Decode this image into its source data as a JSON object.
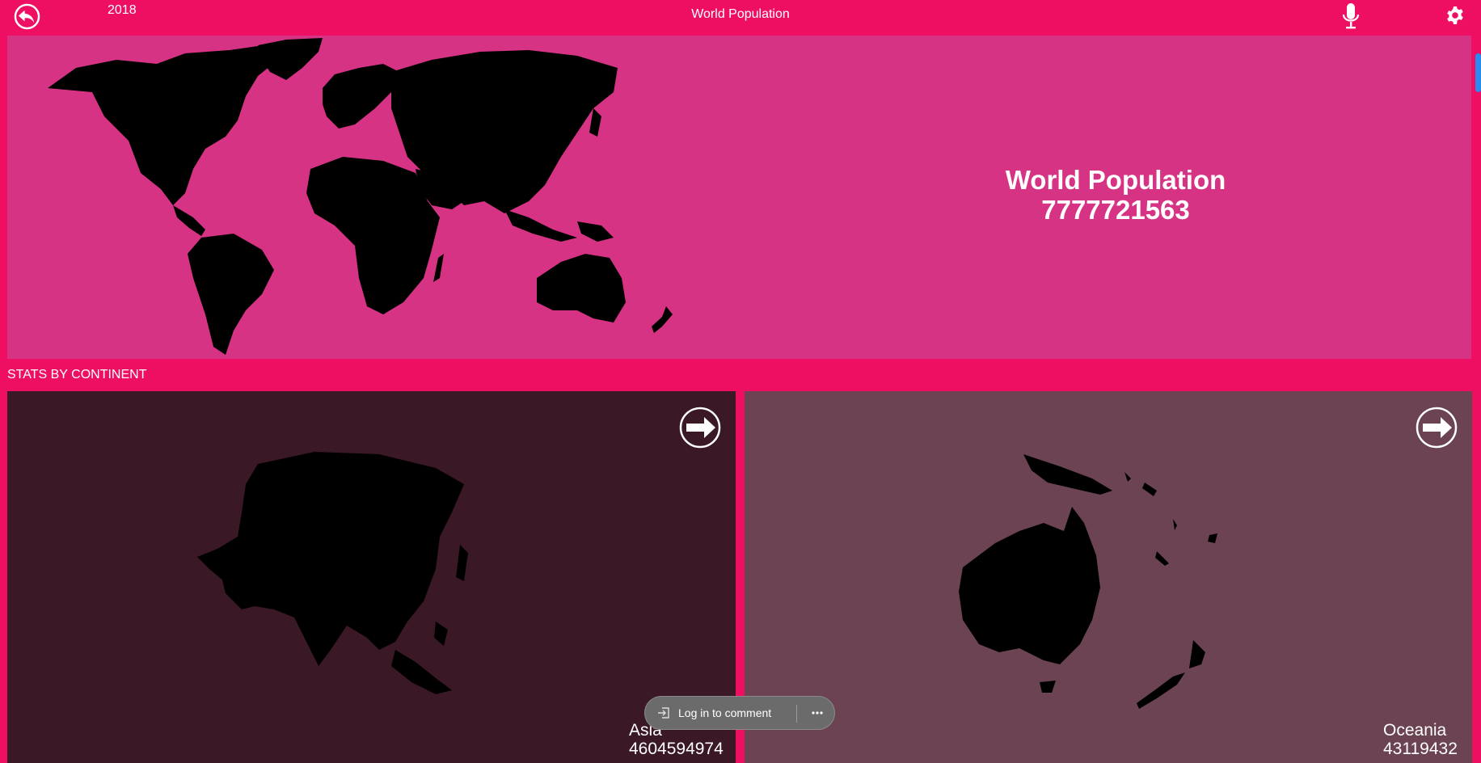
{
  "header": {
    "year": "2018",
    "title": "World Population",
    "icons": [
      "back-icon",
      "microphone-icon",
      "gear-icon"
    ]
  },
  "hero": {
    "title": "World Population",
    "population": "7777721563"
  },
  "section_label": "STATS BY CONTINENT",
  "continents": [
    {
      "name": "Asia",
      "population": "4604594974"
    },
    {
      "name": "Oceania",
      "population": "43119432"
    }
  ],
  "comment_bar": {
    "login_label": "Log in to comment",
    "more_icon": "more-dots-icon"
  },
  "colors": {
    "accent": "#ee0f63",
    "hero_bg": "#d63384",
    "asia_card": "#3b1826",
    "oceania_card": "#6b4352"
  }
}
